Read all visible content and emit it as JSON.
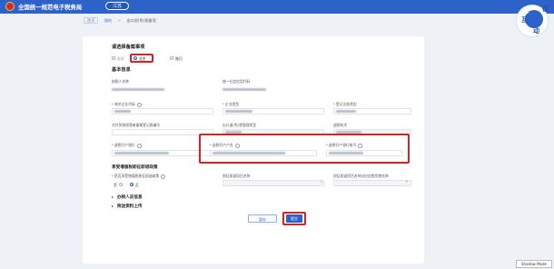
{
  "header": {
    "title": "全国统一规范电子税务局",
    "region": "江苏"
  },
  "breadcrumb": {
    "home": "首页",
    "items": [
      "我的",
      "出口退(免)税备案"
    ]
  },
  "mascot": {
    "chars": [
      "征",
      "纳",
      "互",
      "动"
    ]
  },
  "form": {
    "select_items_title": "请选择备案事项",
    "options": [
      "备案",
      "变更",
      "撤回"
    ],
    "basic_info_title": "基本信息",
    "fields": {
      "taxpayer_id_label": "纳税人名称",
      "credit_code_label": "统一社会信用代码",
      "customs_code_label": "海关企业代码",
      "enterprise_type_label": "企业类型",
      "registration_type_label": "登记注册类型",
      "foreign_trade_label": "对外贸易经营者备案登记表编号",
      "refund_method_label": "出口退(免)税管理类型",
      "refund_method_value": "",
      "tax_authority_label": "退税机关",
      "bank_name_label": "退税开户银行",
      "account_name_label": "退税开户户名",
      "account_number_label": "退税开户银行账号"
    },
    "special_section_title": "享受增值税即征即退政策",
    "special_fields": {
      "policy_label": "是否享受增值税即征即退政策",
      "yes": "是",
      "no": "否",
      "project_label": "即征即退项目名称",
      "project2_label": "即征即退项目名称对应应税货物名称"
    },
    "agent_section_title": "办税人员信息",
    "attachment_section_title": "附送资料上传",
    "buttons": {
      "save": "暂存",
      "submit": "提交"
    }
  },
  "status": {
    "shadow_mode": "Shadow Mode"
  }
}
